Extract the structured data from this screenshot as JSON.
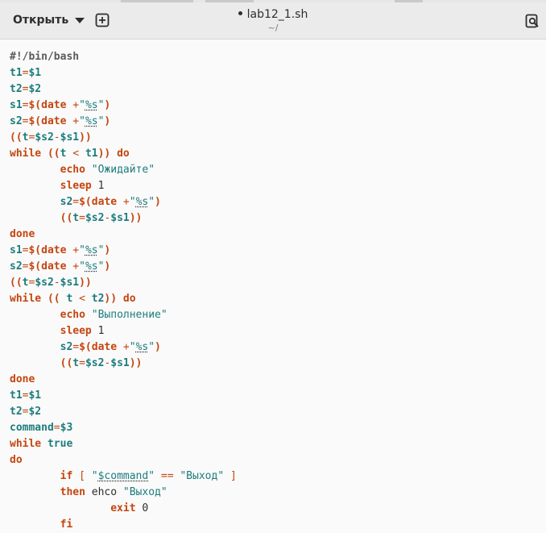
{
  "header": {
    "open_label": "Открыть",
    "title": "lab12_1.sh",
    "subtitle": "~/"
  },
  "icons": {
    "open_menu": "chevron-down-icon",
    "new_tab": "new-tab-icon",
    "search": "search-icon"
  },
  "colors": {
    "keyword": "#c4460f",
    "variable": "#1d7c7c",
    "string": "#1d7c7c",
    "text": "#2e2e2e",
    "background": "#fafafa",
    "headerbar": "#ebebeb"
  },
  "code_lines": [
    [
      {
        "t": "#!/bin/bash",
        "c": "kw-plain"
      }
    ],
    [
      {
        "t": "t1",
        "c": "var"
      },
      {
        "t": "=",
        "c": "op"
      },
      {
        "t": "$1",
        "c": "var"
      }
    ],
    [
      {
        "t": "t2",
        "c": "var"
      },
      {
        "t": "=",
        "c": "op"
      },
      {
        "t": "$2",
        "c": "var"
      }
    ],
    [
      {
        "t": "s1",
        "c": "var"
      },
      {
        "t": "=",
        "c": "op"
      },
      {
        "t": "$(date ",
        "c": "kw"
      },
      {
        "t": "+",
        "c": "op"
      },
      {
        "t": "\"",
        "c": "str"
      },
      {
        "t": "%s",
        "c": "str-u"
      },
      {
        "t": "\"",
        "c": "str"
      },
      {
        "t": ")",
        "c": "kw"
      }
    ],
    [
      {
        "t": "s2",
        "c": "var"
      },
      {
        "t": "=",
        "c": "op"
      },
      {
        "t": "$(date ",
        "c": "kw"
      },
      {
        "t": "+",
        "c": "op"
      },
      {
        "t": "\"",
        "c": "str"
      },
      {
        "t": "%s",
        "c": "str-u"
      },
      {
        "t": "\"",
        "c": "str"
      },
      {
        "t": ")",
        "c": "kw"
      }
    ],
    [
      {
        "t": "((",
        "c": "kw"
      },
      {
        "t": "t",
        "c": "var"
      },
      {
        "t": "=",
        "c": "op"
      },
      {
        "t": "$s2",
        "c": "var"
      },
      {
        "t": "-",
        "c": "op"
      },
      {
        "t": "$s1",
        "c": "var"
      },
      {
        "t": "))",
        "c": "kw"
      }
    ],
    [
      {
        "t": "while",
        "c": "kw"
      },
      {
        "t": " ((",
        "c": "kw"
      },
      {
        "t": "t",
        "c": "var"
      },
      {
        "t": " < ",
        "c": "op"
      },
      {
        "t": "t1",
        "c": "var"
      },
      {
        "t": "))",
        "c": "kw"
      },
      {
        "t": " do",
        "c": "kw"
      }
    ],
    [
      {
        "t": "        ",
        "c": "plain"
      },
      {
        "t": "echo",
        "c": "kw"
      },
      {
        "t": " \"Ожидайте\"",
        "c": "str"
      }
    ],
    [
      {
        "t": "        ",
        "c": "plain"
      },
      {
        "t": "sleep",
        "c": "kw"
      },
      {
        "t": " 1",
        "c": "plain"
      }
    ],
    [
      {
        "t": "        ",
        "c": "plain"
      },
      {
        "t": "s2",
        "c": "var"
      },
      {
        "t": "=",
        "c": "op"
      },
      {
        "t": "$(date ",
        "c": "kw"
      },
      {
        "t": "+",
        "c": "op"
      },
      {
        "t": "\"",
        "c": "str"
      },
      {
        "t": "%s",
        "c": "str-u"
      },
      {
        "t": "\"",
        "c": "str"
      },
      {
        "t": ")",
        "c": "kw"
      }
    ],
    [
      {
        "t": "        ",
        "c": "plain"
      },
      {
        "t": "((",
        "c": "kw"
      },
      {
        "t": "t",
        "c": "var"
      },
      {
        "t": "=",
        "c": "op"
      },
      {
        "t": "$s2",
        "c": "var"
      },
      {
        "t": "-",
        "c": "op"
      },
      {
        "t": "$s1",
        "c": "var"
      },
      {
        "t": "))",
        "c": "kw"
      }
    ],
    [
      {
        "t": "done",
        "c": "kw"
      }
    ],
    [
      {
        "t": "s1",
        "c": "var"
      },
      {
        "t": "=",
        "c": "op"
      },
      {
        "t": "$(date ",
        "c": "kw"
      },
      {
        "t": "+",
        "c": "op"
      },
      {
        "t": "\"",
        "c": "str"
      },
      {
        "t": "%s",
        "c": "str-u"
      },
      {
        "t": "\"",
        "c": "str"
      },
      {
        "t": ")",
        "c": "kw"
      }
    ],
    [
      {
        "t": "s2",
        "c": "var"
      },
      {
        "t": "=",
        "c": "op"
      },
      {
        "t": "$(date ",
        "c": "kw"
      },
      {
        "t": "+",
        "c": "op"
      },
      {
        "t": "\"",
        "c": "str"
      },
      {
        "t": "%s",
        "c": "str-u"
      },
      {
        "t": "\"",
        "c": "str"
      },
      {
        "t": ")",
        "c": "kw"
      }
    ],
    [
      {
        "t": "((",
        "c": "kw"
      },
      {
        "t": "t",
        "c": "var"
      },
      {
        "t": "=",
        "c": "op"
      },
      {
        "t": "$s2",
        "c": "var"
      },
      {
        "t": "-",
        "c": "op"
      },
      {
        "t": "$s1",
        "c": "var"
      },
      {
        "t": "))",
        "c": "kw"
      }
    ],
    [
      {
        "t": "while",
        "c": "kw"
      },
      {
        "t": " (( ",
        "c": "kw"
      },
      {
        "t": "t",
        "c": "var"
      },
      {
        "t": " < ",
        "c": "op"
      },
      {
        "t": "t2",
        "c": "var"
      },
      {
        "t": "))",
        "c": "kw"
      },
      {
        "t": " do",
        "c": "kw"
      }
    ],
    [
      {
        "t": "        ",
        "c": "plain"
      },
      {
        "t": "echo",
        "c": "kw"
      },
      {
        "t": " \"Выполнение\"",
        "c": "str"
      }
    ],
    [
      {
        "t": "        ",
        "c": "plain"
      },
      {
        "t": "sleep",
        "c": "kw"
      },
      {
        "t": " 1",
        "c": "plain"
      }
    ],
    [
      {
        "t": "        ",
        "c": "plain"
      },
      {
        "t": "s2",
        "c": "var"
      },
      {
        "t": "=",
        "c": "op"
      },
      {
        "t": "$(date ",
        "c": "kw"
      },
      {
        "t": "+",
        "c": "op"
      },
      {
        "t": "\"",
        "c": "str"
      },
      {
        "t": "%s",
        "c": "str-u"
      },
      {
        "t": "\"",
        "c": "str"
      },
      {
        "t": ")",
        "c": "kw"
      }
    ],
    [
      {
        "t": "        ",
        "c": "plain"
      },
      {
        "t": "((",
        "c": "kw"
      },
      {
        "t": "t",
        "c": "var"
      },
      {
        "t": "=",
        "c": "op"
      },
      {
        "t": "$s2",
        "c": "var"
      },
      {
        "t": "-",
        "c": "op"
      },
      {
        "t": "$s1",
        "c": "var"
      },
      {
        "t": "))",
        "c": "kw"
      }
    ],
    [
      {
        "t": "done",
        "c": "kw"
      }
    ],
    [
      {
        "t": "t1",
        "c": "var"
      },
      {
        "t": "=",
        "c": "op"
      },
      {
        "t": "$1",
        "c": "var"
      }
    ],
    [
      {
        "t": "t2",
        "c": "var"
      },
      {
        "t": "=",
        "c": "op"
      },
      {
        "t": "$2",
        "c": "var"
      }
    ],
    [
      {
        "t": "command",
        "c": "var"
      },
      {
        "t": "=",
        "c": "op"
      },
      {
        "t": "$3",
        "c": "var"
      }
    ],
    [
      {
        "t": "while",
        "c": "kw"
      },
      {
        "t": " true",
        "c": "var"
      }
    ],
    [
      {
        "t": "do",
        "c": "kw"
      }
    ],
    [
      {
        "t": "        ",
        "c": "plain"
      },
      {
        "t": "if",
        "c": "kw"
      },
      {
        "t": " [ ",
        "c": "op"
      },
      {
        "t": "\"",
        "c": "str"
      },
      {
        "t": "$command",
        "c": "str-u"
      },
      {
        "t": "\"",
        "c": "str"
      },
      {
        "t": " == ",
        "c": "op"
      },
      {
        "t": "\"Выход\"",
        "c": "str"
      },
      {
        "t": " ]",
        "c": "op"
      }
    ],
    [
      {
        "t": "        ",
        "c": "plain"
      },
      {
        "t": "then",
        "c": "kw"
      },
      {
        "t": " ehco ",
        "c": "plain"
      },
      {
        "t": "\"Выход\"",
        "c": "str"
      }
    ],
    [
      {
        "t": "                ",
        "c": "plain"
      },
      {
        "t": "exit",
        "c": "kw"
      },
      {
        "t": " 0",
        "c": "plain"
      }
    ],
    [
      {
        "t": "        ",
        "c": "plain"
      },
      {
        "t": "fi",
        "c": "kw"
      }
    ]
  ]
}
